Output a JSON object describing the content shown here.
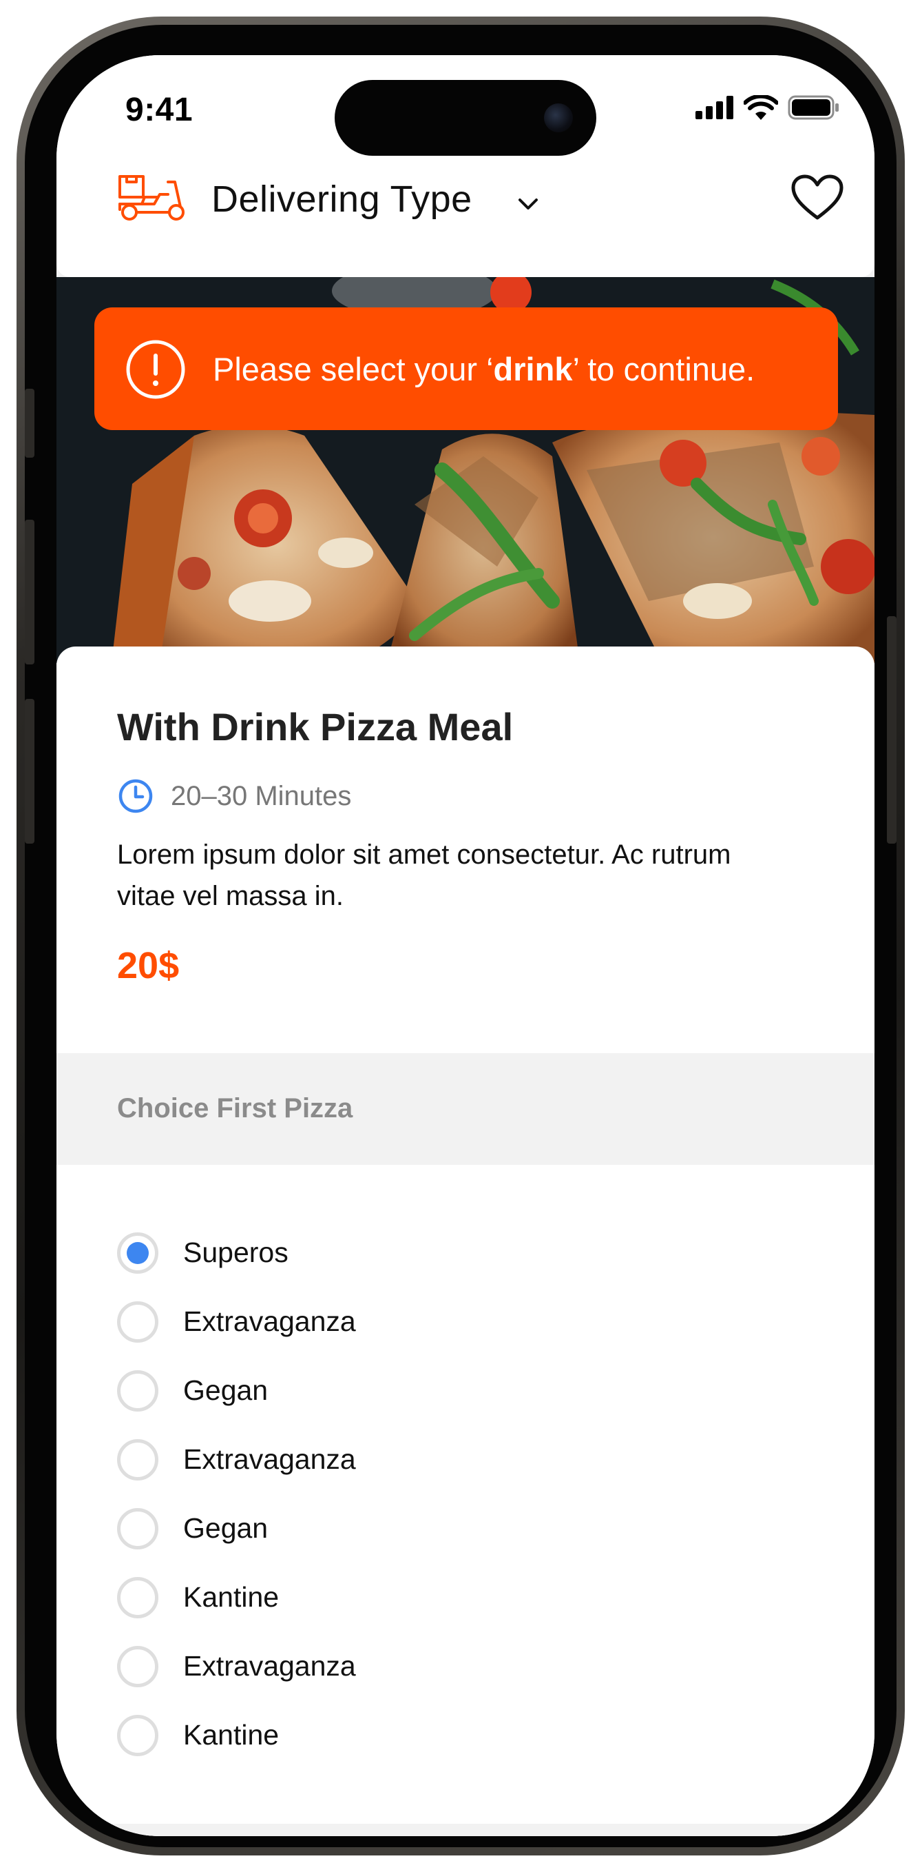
{
  "status_bar": {
    "time": "9:41",
    "icons": [
      "signal-icon",
      "wifi-icon",
      "battery-icon"
    ]
  },
  "header": {
    "title": "Delivering Type",
    "logo_icon": "delivery-scooter-icon",
    "chevron_icon": "chevron-down-icon",
    "favorite_icon": "heart-icon"
  },
  "alert": {
    "prefix": "Please select your ‘",
    "highlight": "drink",
    "suffix": "’ to continue.",
    "icon": "exclamation-icon"
  },
  "product": {
    "title": "With Drink Pizza Meal",
    "time": "20–30 Minutes",
    "description": "Lorem ipsum dolor sit amet consectetur. Ac rutrum vitae vel massa in.",
    "price": "20$"
  },
  "section": {
    "title": "Choice First Pizza"
  },
  "options": [
    {
      "label": "Superos",
      "selected": true
    },
    {
      "label": "Extravaganza",
      "selected": false
    },
    {
      "label": "Gegan",
      "selected": false
    },
    {
      "label": "Extravaganza",
      "selected": false
    },
    {
      "label": "Gegan",
      "selected": false
    },
    {
      "label": "Kantine",
      "selected": false
    },
    {
      "label": "Extravaganza",
      "selected": false
    },
    {
      "label": "Kantine",
      "selected": false
    }
  ],
  "colors": {
    "accent": "#ff4d00",
    "radio_selected": "#3d86f0",
    "clock": "#3d86f0",
    "section_background": "#f2f2f2"
  }
}
